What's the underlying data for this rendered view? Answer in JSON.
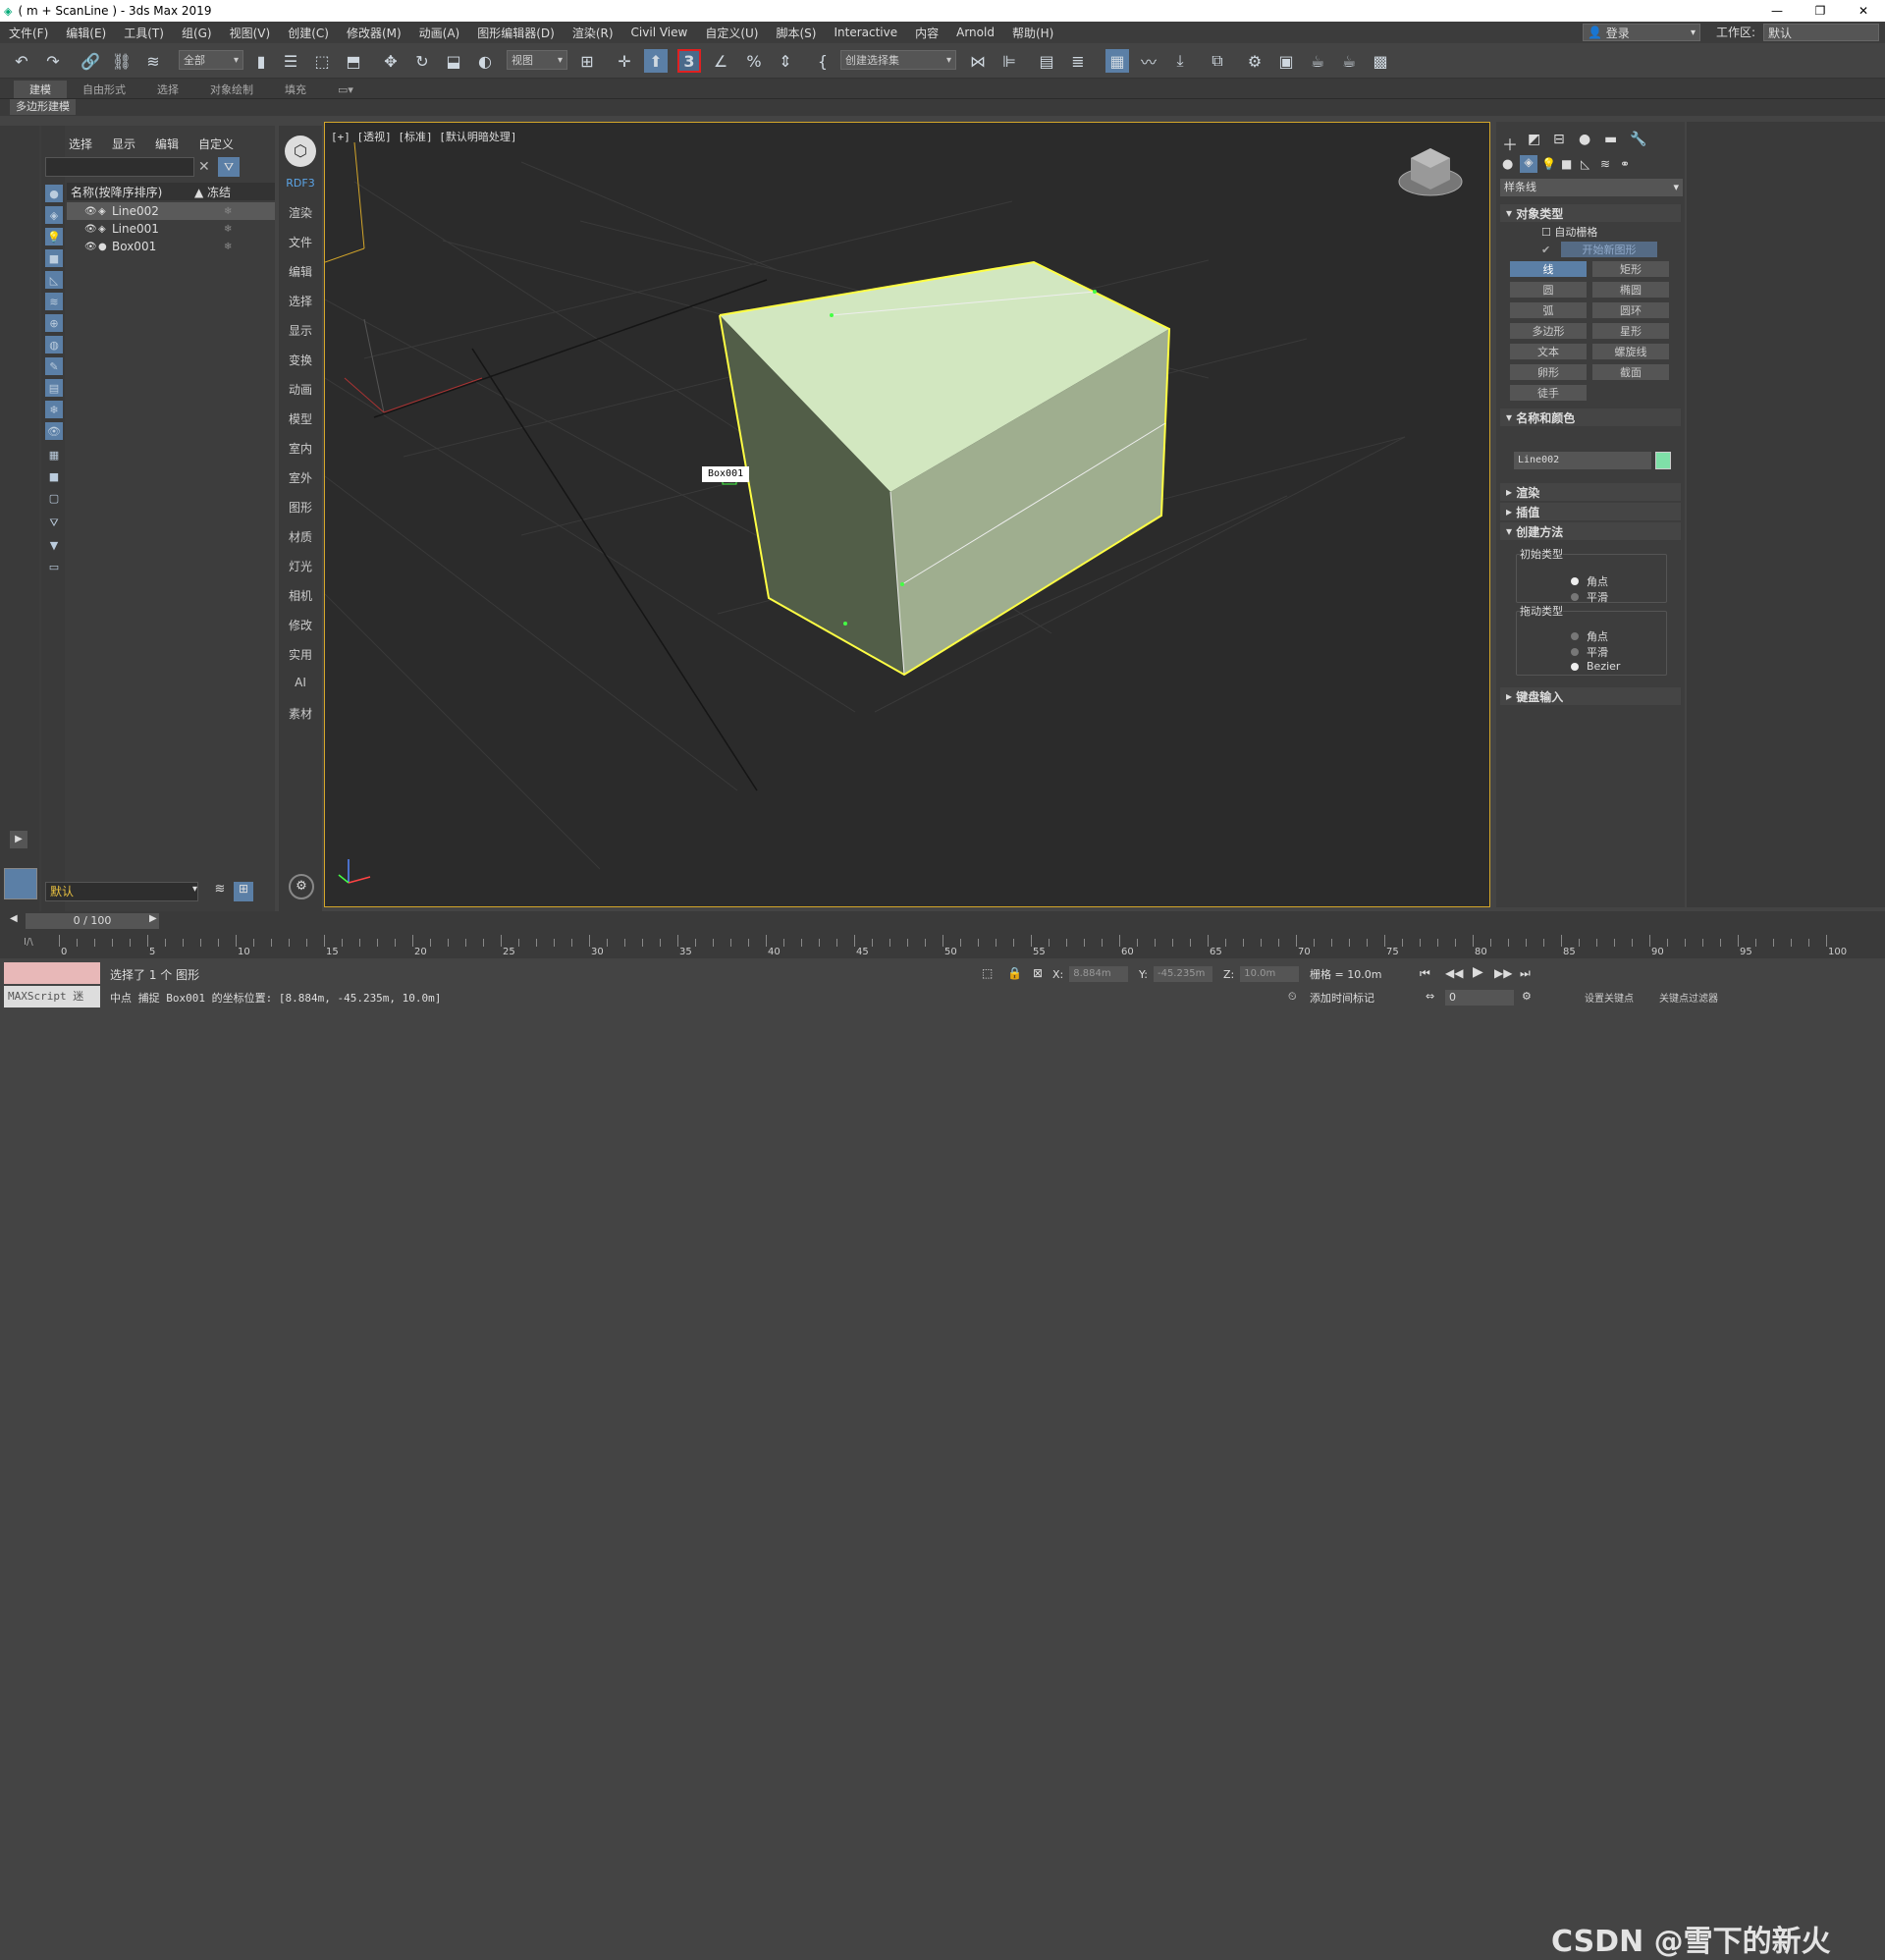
{
  "window": {
    "title": "( m + ScanLine ) - 3ds Max 2019",
    "controls": [
      "—",
      "❐",
      "✕"
    ]
  },
  "menu": [
    "文件(F)",
    "编辑(E)",
    "工具(T)",
    "组(G)",
    "视图(V)",
    "创建(C)",
    "修改器(M)",
    "动画(A)",
    "图形编辑器(D)",
    "渲染(R)",
    "Civil View",
    "自定义(U)",
    "脚本(S)",
    "Interactive",
    "内容",
    "Arnold",
    "帮助(H)"
  ],
  "account": {
    "login": "登录",
    "workspace_label": "工作区:",
    "workspace_value": "默认"
  },
  "toolbar": {
    "filter_value": "全部",
    "ref_coord": "视图",
    "selection_set": "创建选择集",
    "snap_number": "3"
  },
  "ribbon": {
    "tabs": [
      "建模",
      "自由形式",
      "选择",
      "对象绘制",
      "填充"
    ],
    "sub_label": "多边形建模"
  },
  "scene_explorer": {
    "tabs": [
      "选择",
      "显示",
      "编辑",
      "自定义"
    ],
    "col_name": "名称(按降序排序)",
    "col_freeze": "▲ 冻结",
    "rows": [
      {
        "name": "Line002",
        "selected": true
      },
      {
        "name": "Line001",
        "selected": false
      },
      {
        "name": "Box001",
        "selected": false
      }
    ],
    "layer": "默认"
  },
  "viewport_nav": [
    "RDF3",
    "渲染",
    "文件",
    "编辑",
    "选择",
    "显示",
    "变换",
    "动画",
    "模型",
    "室内",
    "室外",
    "图形",
    "材质",
    "灯光",
    "相机",
    "修改",
    "实用",
    "AI",
    "素材"
  ],
  "viewport": {
    "label": "[+] [透视] [标准] [默认明暗处理]",
    "tooltip": "Box001",
    "box_color": "#cfe2bd",
    "selection_color": "#ffff44"
  },
  "command_panel": {
    "category": "样条线",
    "rollouts": {
      "object_type": "对象类型",
      "auto_grid": "自动栅格",
      "start_new_shape": "开始新图形",
      "buttons": [
        "线",
        "矩形",
        "圆",
        "椭圆",
        "弧",
        "圆环",
        "多边形",
        "星形",
        "文本",
        "螺旋线",
        "卵形",
        "截面",
        "徒手"
      ],
      "name_color": "名称和颜色",
      "object_name": "Line002",
      "object_color": "#7fe0a8",
      "render": "渲染",
      "interpolation": "插值",
      "creation_method": "创建方法",
      "initial_type": "初始类型",
      "initial_options": [
        "角点",
        "平滑"
      ],
      "drag_type": "拖动类型",
      "drag_options": [
        "角点",
        "平滑",
        "Bezier"
      ],
      "keyboard": "键盘输入"
    }
  },
  "timeline": {
    "frame": "0 / 100",
    "ticks": [
      0,
      5,
      10,
      15,
      20,
      25,
      30,
      35,
      40,
      45,
      50,
      55,
      60,
      65,
      70,
      75,
      80,
      85,
      90,
      95,
      100
    ]
  },
  "status": {
    "script_label": "MAXScript 迷",
    "line1": "选择了 1 个 图形",
    "line2": "中点 捕捉 Box001 的坐标位置: [8.884m, -45.235m, 10.0m]",
    "x": "8.884m",
    "y": "-45.235m",
    "z": "10.0m",
    "grid": "栅格 = 10.0m",
    "add_time_tag": "添加时间标记",
    "frame_value": "0",
    "set_key": "设置关键点",
    "key_filter": "关键点过滤器"
  },
  "watermark": "CSDN @雪下的新火"
}
